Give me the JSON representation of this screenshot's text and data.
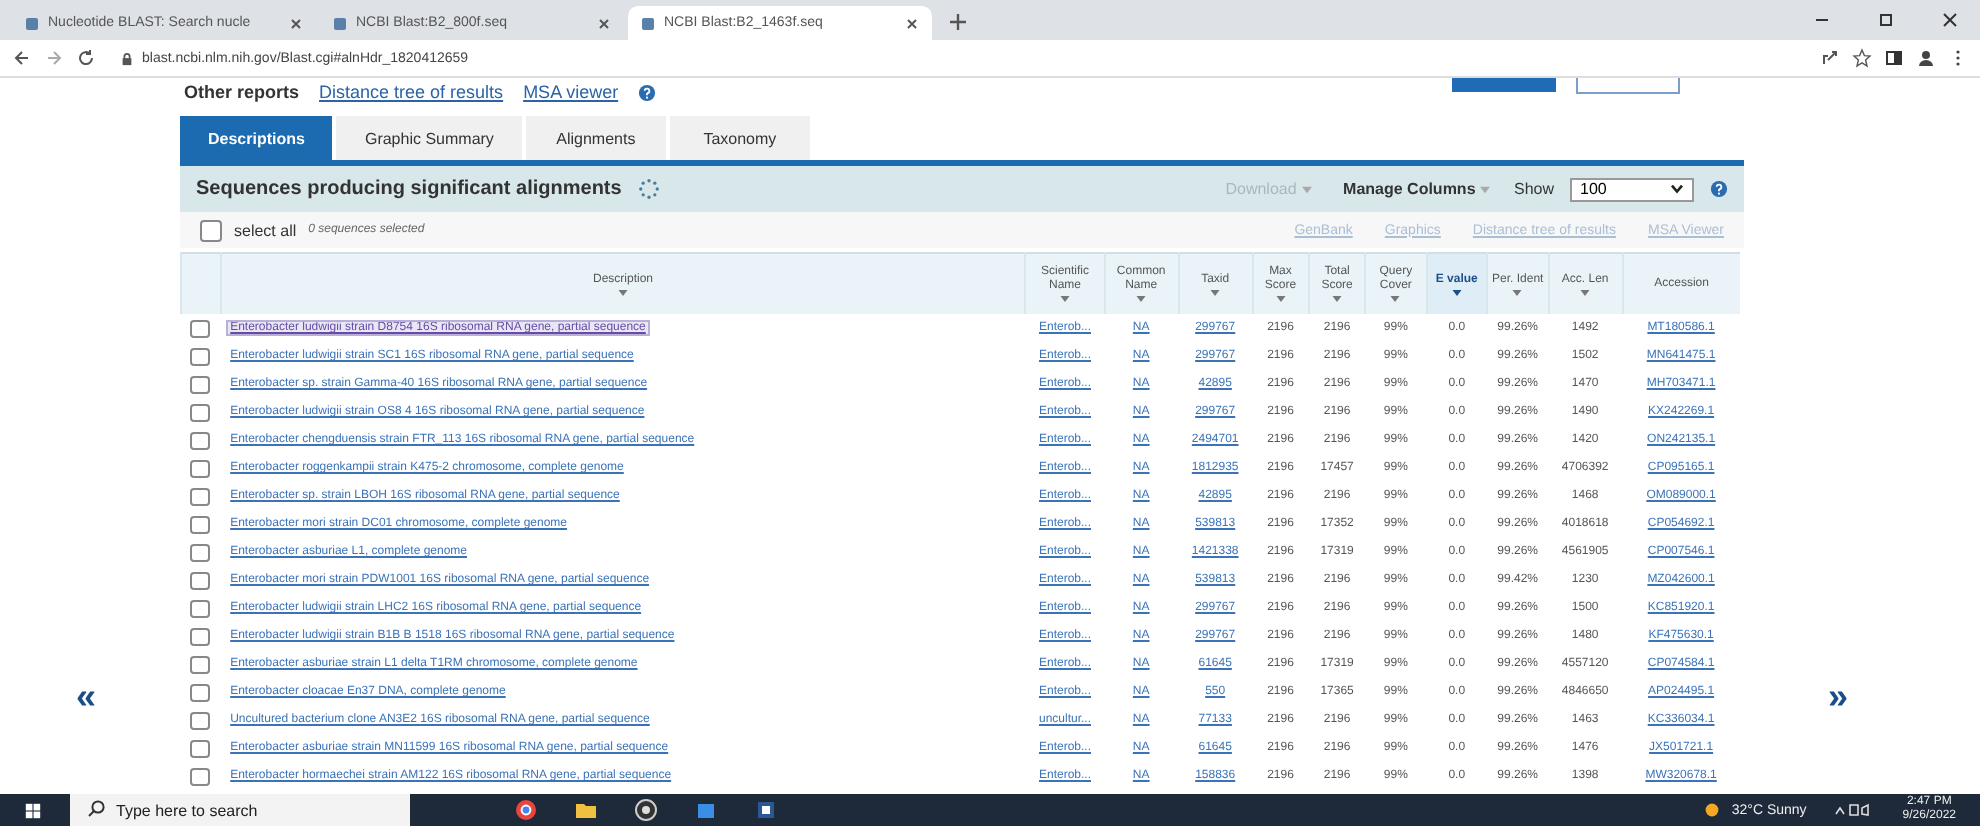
{
  "browser": {
    "tabs": [
      {
        "title": "Nucleotide BLAST: Search nucle",
        "selected": false
      },
      {
        "title": "NCBI Blast:B2_800f.seq",
        "selected": false
      },
      {
        "title": "NCBI Blast:B2_1463f.seq",
        "selected": true
      }
    ],
    "url": "blast.ncbi.nlm.nih.gov/Blast.cgi#alnHdr_1820412659"
  },
  "other_reports": {
    "label": "Other reports",
    "links": [
      "Distance tree of results",
      "MSA viewer"
    ]
  },
  "result_tabs": [
    {
      "label": "Descriptions",
      "selected": true
    },
    {
      "label": "Graphic Summary",
      "selected": false
    },
    {
      "label": "Alignments",
      "selected": false
    },
    {
      "label": "Taxonomy",
      "selected": false
    }
  ],
  "panel": {
    "title": "Sequences producing significant alignments",
    "download": {
      "label": "Download",
      "disabled": true
    },
    "manage_columns": "Manage Columns",
    "show_label": "Show",
    "show_value": "100",
    "select_all": {
      "label": "select all",
      "checked": false
    },
    "selected_count": "0 sequences selected",
    "actions": [
      {
        "label": "GenBank",
        "disabled": true
      },
      {
        "label": "Graphics",
        "disabled": true
      },
      {
        "label": "Distance tree of results",
        "disabled": true
      },
      {
        "label": "MSA Viewer",
        "disabled": true
      }
    ]
  },
  "table": {
    "columns": [
      {
        "label": "Description",
        "sortable": true,
        "sorted": false
      },
      {
        "label": "Scientific Name",
        "sortable": true,
        "sorted": false
      },
      {
        "label": "Common Name",
        "sortable": true,
        "sorted": false
      },
      {
        "label": "Taxid",
        "sortable": true,
        "sorted": false
      },
      {
        "label": "Max Score",
        "sortable": true,
        "sorted": false
      },
      {
        "label": "Total Score",
        "sortable": true,
        "sorted": false
      },
      {
        "label": "Query Cover",
        "sortable": true,
        "sorted": false
      },
      {
        "label": "E value",
        "sortable": true,
        "sorted": true
      },
      {
        "label": "Per. Ident",
        "sortable": true,
        "sorted": false
      },
      {
        "label": "Acc. Len",
        "sortable": true,
        "sorted": false
      },
      {
        "label": "Accession",
        "sortable": false,
        "sorted": false
      }
    ],
    "rows": [
      {
        "selected": true,
        "checked": false,
        "cells": [
          "Enterobacter ludwigii strain D8754 16S ribosomal RNA gene, partial sequence",
          "Enterob...",
          "NA",
          "299767",
          "2196",
          "2196",
          "99%",
          "0.0",
          "99.26%",
          "1492",
          "MT180586.1"
        ]
      },
      {
        "selected": false,
        "checked": false,
        "cells": [
          "Enterobacter ludwigii strain SC1 16S ribosomal RNA gene, partial sequence",
          "Enterob...",
          "NA",
          "299767",
          "2196",
          "2196",
          "99%",
          "0.0",
          "99.26%",
          "1502",
          "MN641475.1"
        ]
      },
      {
        "selected": false,
        "checked": false,
        "cells": [
          "Enterobacter sp. strain Gamma-40 16S ribosomal RNA gene, partial sequence",
          "Enterob...",
          "NA",
          "42895",
          "2196",
          "2196",
          "99%",
          "0.0",
          "99.26%",
          "1470",
          "MH703471.1"
        ]
      },
      {
        "selected": false,
        "checked": false,
        "cells": [
          "Enterobacter ludwigii strain OS8 4 16S ribosomal RNA gene, partial sequence",
          "Enterob...",
          "NA",
          "299767",
          "2196",
          "2196",
          "99%",
          "0.0",
          "99.26%",
          "1490",
          "KX242269.1"
        ]
      },
      {
        "selected": false,
        "checked": false,
        "cells": [
          "Enterobacter chengduensis strain FTR_113 16S ribosomal RNA gene, partial sequence",
          "Enterob...",
          "NA",
          "2494701",
          "2196",
          "2196",
          "99%",
          "0.0",
          "99.26%",
          "1420",
          "ON242135.1"
        ]
      },
      {
        "selected": false,
        "checked": false,
        "cells": [
          "Enterobacter roggenkampii strain K475-2 chromosome, complete genome",
          "Enterob...",
          "NA",
          "1812935",
          "2196",
          "17457",
          "99%",
          "0.0",
          "99.26%",
          "4706392",
          "CP095165.1"
        ]
      },
      {
        "selected": false,
        "checked": false,
        "cells": [
          "Enterobacter sp. strain LBOH 16S ribosomal RNA gene, partial sequence",
          "Enterob...",
          "NA",
          "42895",
          "2196",
          "2196",
          "99%",
          "0.0",
          "99.26%",
          "1468",
          "OM089000.1"
        ]
      },
      {
        "selected": false,
        "checked": false,
        "cells": [
          "Enterobacter mori strain DC01 chromosome, complete genome",
          "Enterob...",
          "NA",
          "539813",
          "2196",
          "17352",
          "99%",
          "0.0",
          "99.26%",
          "4018618",
          "CP054692.1"
        ]
      },
      {
        "selected": false,
        "checked": false,
        "cells": [
          "Enterobacter asburiae L1, complete genome",
          "Enterob...",
          "NA",
          "1421338",
          "2196",
          "17319",
          "99%",
          "0.0",
          "99.26%",
          "4561905",
          "CP007546.1"
        ]
      },
      {
        "selected": false,
        "checked": false,
        "cells": [
          "Enterobacter mori strain PDW1001 16S ribosomal RNA gene, partial sequence",
          "Enterob...",
          "NA",
          "539813",
          "2196",
          "2196",
          "99%",
          "0.0",
          "99.42%",
          "1230",
          "MZ042600.1"
        ]
      },
      {
        "selected": false,
        "checked": false,
        "cells": [
          "Enterobacter ludwigii strain LHC2 16S ribosomal RNA gene, partial sequence",
          "Enterob...",
          "NA",
          "299767",
          "2196",
          "2196",
          "99%",
          "0.0",
          "99.26%",
          "1500",
          "KC851920.1"
        ]
      },
      {
        "selected": false,
        "checked": false,
        "cells": [
          "Enterobacter ludwigii strain B1B B 1518 16S ribosomal RNA gene, partial sequence",
          "Enterob...",
          "NA",
          "299767",
          "2196",
          "2196",
          "99%",
          "0.0",
          "99.26%",
          "1480",
          "KF475630.1"
        ]
      },
      {
        "selected": false,
        "checked": false,
        "cells": [
          "Enterobacter asburiae strain L1 delta T1RM chromosome, complete genome",
          "Enterob...",
          "NA",
          "61645",
          "2196",
          "17319",
          "99%",
          "0.0",
          "99.26%",
          "4557120",
          "CP074584.1"
        ]
      },
      {
        "selected": false,
        "checked": false,
        "cells": [
          "Enterobacter cloacae En37 DNA, complete genome",
          "Enterob...",
          "NA",
          "550",
          "2196",
          "17365",
          "99%",
          "0.0",
          "99.26%",
          "4846650",
          "AP024495.1"
        ]
      },
      {
        "selected": false,
        "checked": false,
        "cells": [
          "Uncultured bacterium clone AN3E2 16S ribosomal RNA gene, partial sequence",
          "uncultur...",
          "NA",
          "77133",
          "2196",
          "2196",
          "99%",
          "0.0",
          "99.26%",
          "1463",
          "KC336034.1"
        ]
      },
      {
        "selected": false,
        "checked": false,
        "cells": [
          "Enterobacter asburiae strain MN11599 16S ribosomal RNA gene, partial sequence",
          "Enterob...",
          "NA",
          "61645",
          "2196",
          "2196",
          "99%",
          "0.0",
          "99.26%",
          "1476",
          "JX501721.1"
        ]
      },
      {
        "selected": false,
        "checked": false,
        "cells": [
          "Enterobacter hormaechei strain AM122 16S ribosomal RNA gene, partial sequence",
          "Enterob...",
          "NA",
          "158836",
          "2196",
          "2196",
          "99%",
          "0.0",
          "99.26%",
          "1398",
          "MW320678.1"
        ]
      }
    ]
  },
  "nav": {
    "previous": "«",
    "next": "»"
  },
  "taskbar": {
    "search_placeholder": "Type here to search",
    "weather": "32°C Sunny",
    "time": "2:47 PM",
    "date": "9/26/2022"
  }
}
